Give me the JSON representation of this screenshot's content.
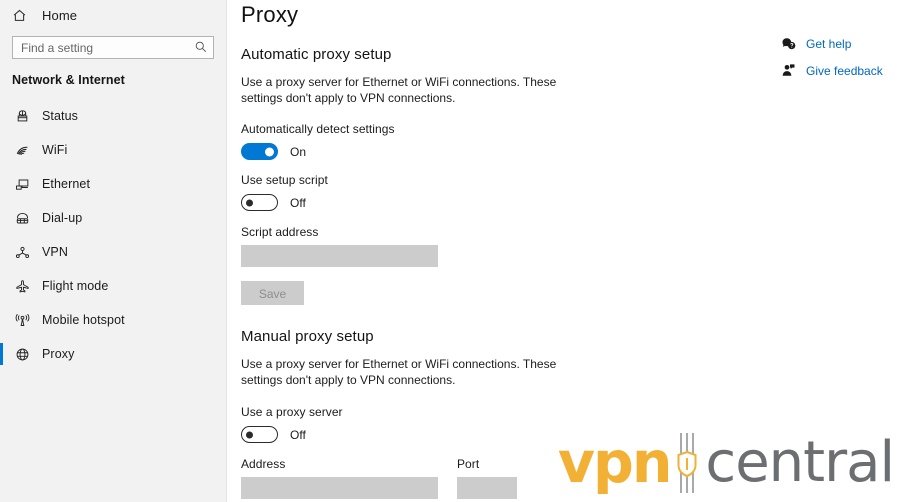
{
  "sidebar": {
    "home": {
      "label": "Home",
      "icon": "home-icon"
    },
    "search": {
      "value": "",
      "placeholder": "Find a setting",
      "icon": "search-icon"
    },
    "category_title": "Network & Internet",
    "items": [
      {
        "label": "Status",
        "icon": "status-icon",
        "selected": false
      },
      {
        "label": "WiFi",
        "icon": "wifi-icon",
        "selected": false
      },
      {
        "label": "Ethernet",
        "icon": "ethernet-icon",
        "selected": false
      },
      {
        "label": "Dial-up",
        "icon": "dialup-icon",
        "selected": false
      },
      {
        "label": "VPN",
        "icon": "vpn-icon",
        "selected": false
      },
      {
        "label": "Flight mode",
        "icon": "airplane-icon",
        "selected": false
      },
      {
        "label": "Mobile hotspot",
        "icon": "mobile-hotspot-icon",
        "selected": false
      },
      {
        "label": "Proxy",
        "icon": "globe-icon",
        "selected": true
      }
    ]
  },
  "main": {
    "page_title": "Proxy",
    "automatic": {
      "heading": "Automatic proxy setup",
      "description": "Use a proxy server for Ethernet or WiFi connections. These settings don't apply to VPN connections.",
      "auto_detect": {
        "label": "Automatically detect settings",
        "state": "On",
        "on": true
      },
      "setup_script": {
        "label": "Use setup script",
        "state": "Off",
        "on": false
      },
      "script_address": {
        "label": "Script address",
        "value": "",
        "placeholder": ""
      },
      "save_label": "Save"
    },
    "manual": {
      "heading": "Manual proxy setup",
      "description": "Use a proxy server for Ethernet or WiFi connections. These settings don't apply to VPN connections.",
      "use_proxy": {
        "label": "Use a proxy server",
        "state": "Off",
        "on": false
      },
      "address": {
        "label": "Address",
        "value": "",
        "placeholder": ""
      },
      "port": {
        "label": "Port",
        "value": "",
        "placeholder": ""
      }
    }
  },
  "help": {
    "links": [
      {
        "label": "Get help",
        "icon": "get-help-icon"
      },
      {
        "label": "Give feedback",
        "icon": "give-feedback-icon"
      }
    ]
  },
  "watermark": {
    "brand_first": "vpn",
    "brand_second": "central"
  },
  "colors": {
    "accent": "#0078d4",
    "link": "#0067c0",
    "sidebar_bg": "#f2f2f2",
    "disabled_field": "#cccccc",
    "brand_orange": "#f2b134",
    "brand_grey": "#6d6e71"
  }
}
